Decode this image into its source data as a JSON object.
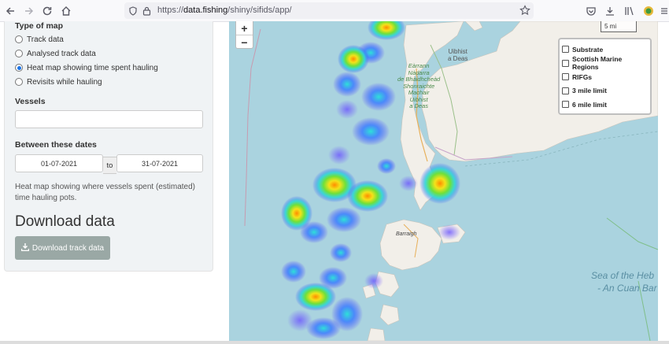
{
  "browser": {
    "url_prefix": "https://",
    "url_host": "data.fishing",
    "url_path": "/shiny/sifids/app/"
  },
  "sidebar": {
    "map_type_label": "Type of map",
    "map_types": [
      {
        "label": "Track data",
        "selected": false
      },
      {
        "label": "Analysed track data",
        "selected": false
      },
      {
        "label": "Heat map showing time spent hauling",
        "selected": true
      },
      {
        "label": "Revisits while hauling",
        "selected": false
      }
    ],
    "vessels_label": "Vessels",
    "vessels_value": "",
    "dates_label": "Between these dates",
    "date_from": "01-07-2021",
    "date_to_label": "to",
    "date_to": "31-07-2021",
    "help_text": "Heat map showing where vessels spent (estimated) time hauling pots.",
    "download_heading": "Download data",
    "download_button": "Download track data"
  },
  "map": {
    "zoom_in": "+",
    "zoom_out": "−",
    "scale_label": "5 mi",
    "layers": [
      "Substrate",
      "Scottish Marine Regions",
      "RIFGs",
      "3 mile limit",
      "6 mile limit"
    ],
    "place_labels": {
      "uibhist_a_deas": "Uibhist\na Deas",
      "eilean_gaelic": "Eàrrann\nNàdarra\nde Bhàidhcheàd\nShonraichte\nMachair\nUibhist\na Deas",
      "barraigh": "Barraigh",
      "sea_label": "Sea of the Heb",
      "sea_label2": "- An Cuan Bar"
    },
    "colors": {
      "sea": "#aad3df",
      "land": "#f2efe9",
      "heat_high": "#ff7a00",
      "heat_mid": "#7be32b",
      "heat_low": "#3b6fff"
    }
  }
}
